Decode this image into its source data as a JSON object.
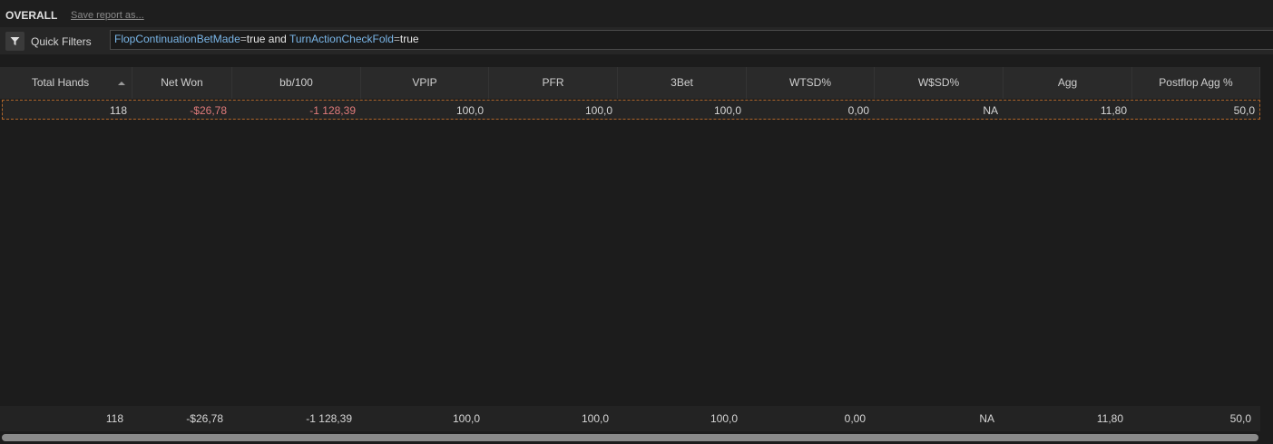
{
  "header": {
    "title": "OVERALL",
    "save_link": "Save report as..."
  },
  "filter": {
    "label": "Quick Filters",
    "icon": "funnel-icon",
    "expression": [
      {
        "t": "kw",
        "s": "FlopContinuationBetMade"
      },
      {
        "t": "op",
        "s": "="
      },
      {
        "t": "val",
        "s": "true and "
      },
      {
        "t": "kw",
        "s": "TurnActionCheckFold"
      },
      {
        "t": "op",
        "s": "="
      },
      {
        "t": "val",
        "s": "true"
      }
    ]
  },
  "table": {
    "columns": [
      "Total Hands",
      "Net Won",
      "bb/100",
      "VPIP",
      "PFR",
      "3Bet",
      "WTSD%",
      "W$SD%",
      "Agg",
      "Postflop Agg %"
    ],
    "sorted_column": "Total Hands",
    "row": [
      "118",
      "-$26,78",
      "-1 128,39",
      "100,0",
      "100,0",
      "100,0",
      "0,00",
      "NA",
      "11,80",
      "50,0"
    ],
    "summary": [
      "118",
      "-$26,78",
      "-1 128,39",
      "100,0",
      "100,0",
      "100,0",
      "0,00",
      "NA",
      "11,80",
      "50,0"
    ]
  },
  "colors": {
    "negative": "#e07b7b",
    "keyword": "#7ab6e8",
    "selection_border": "#b0662a"
  }
}
